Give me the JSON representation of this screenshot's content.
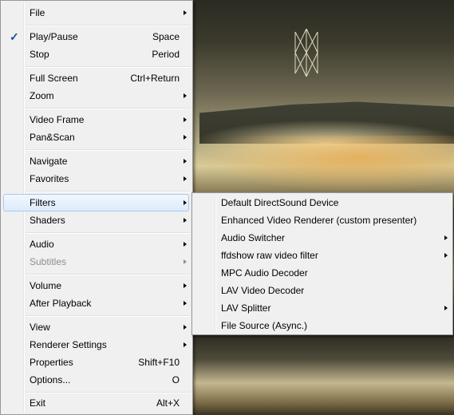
{
  "main_menu": {
    "items": [
      {
        "label": "File",
        "has_submenu": true
      },
      {
        "label": "Play/Pause",
        "accel": "Space",
        "checked": true
      },
      {
        "label": "Stop",
        "accel": "Period"
      },
      {
        "label": "Full Screen",
        "accel": "Ctrl+Return"
      },
      {
        "label": "Zoom",
        "has_submenu": true
      },
      {
        "label": "Video Frame",
        "has_submenu": true
      },
      {
        "label": "Pan&Scan",
        "has_submenu": true
      },
      {
        "label": "Navigate",
        "has_submenu": true
      },
      {
        "label": "Favorites",
        "has_submenu": true
      },
      {
        "label": "Filters",
        "has_submenu": true,
        "highlighted": true
      },
      {
        "label": "Shaders",
        "has_submenu": true
      },
      {
        "label": "Audio",
        "has_submenu": true
      },
      {
        "label": "Subtitles",
        "has_submenu": true,
        "disabled": true
      },
      {
        "label": "Volume",
        "has_submenu": true
      },
      {
        "label": "After Playback",
        "has_submenu": true
      },
      {
        "label": "View",
        "has_submenu": true
      },
      {
        "label": "Renderer Settings",
        "has_submenu": true
      },
      {
        "label": "Properties",
        "accel": "Shift+F10"
      },
      {
        "label": "Options...",
        "accel": "O"
      },
      {
        "label": "Exit",
        "accel": "Alt+X"
      }
    ]
  },
  "filters_submenu": {
    "items": [
      {
        "label": "Default DirectSound Device"
      },
      {
        "label": "Enhanced Video Renderer (custom presenter)"
      },
      {
        "label": "Audio Switcher",
        "has_submenu": true
      },
      {
        "label": "ffdshow raw video filter",
        "has_submenu": true
      },
      {
        "label": "MPC Audio Decoder"
      },
      {
        "label": "LAV Video Decoder"
      },
      {
        "label": "LAV Splitter",
        "has_submenu": true
      },
      {
        "label": "File Source (Async.)"
      }
    ]
  },
  "icons": {
    "check": "checkmark-icon",
    "submenu_arrow": "submenu-arrow-icon"
  },
  "colors": {
    "menu_background": "#f0f0f0",
    "highlight_border": "#a8caf0",
    "disabled_text": "#8d8d8d",
    "check_color": "#1a4ea0"
  }
}
